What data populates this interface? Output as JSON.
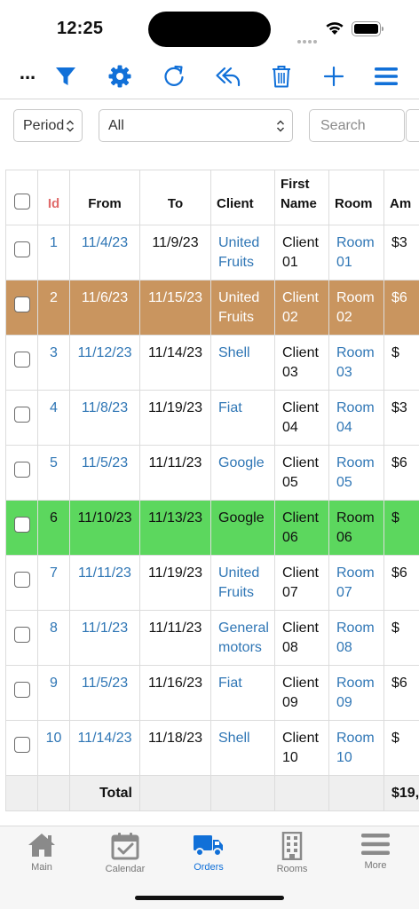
{
  "status": {
    "time": "12:25"
  },
  "colors": {
    "accent": "#1170d8",
    "link": "#2f76b5",
    "row_highlight_brown": "#c9955f",
    "row_highlight_green": "#5cd75e"
  },
  "toolbar": {
    "more_label": "...",
    "icons": [
      "filter-icon",
      "gear-icon",
      "refresh-icon",
      "reply-icon",
      "trash-icon",
      "plus-icon",
      "menu-icon"
    ]
  },
  "filters": {
    "period": "Period",
    "scope": "All",
    "search_placeholder": "Search"
  },
  "table": {
    "headers": {
      "id": "Id",
      "from": "From",
      "to": "To",
      "client": "Client",
      "first_name_1": "First",
      "first_name_2": "Name",
      "room": "Room",
      "amount": "Am"
    },
    "rows": [
      {
        "id": "1",
        "from": "11/4/23",
        "to": "11/9/23",
        "client_1": "United",
        "client_2": "Fruits",
        "first_1": "Client",
        "first_2": "01",
        "room_1": "Room",
        "room_2": "01",
        "amount": "$3"
      },
      {
        "id": "2",
        "from": "11/6/23",
        "to": "11/15/23",
        "client_1": "United",
        "client_2": "Fruits",
        "first_1": "Client",
        "first_2": "02",
        "room_1": "Room",
        "room_2": "02",
        "amount": "$6"
      },
      {
        "id": "3",
        "from": "11/12/23",
        "to": "11/14/23",
        "client_1": "Shell",
        "client_2": "",
        "first_1": "Client",
        "first_2": "03",
        "room_1": "Room",
        "room_2": "03",
        "amount": "$"
      },
      {
        "id": "4",
        "from": "11/8/23",
        "to": "11/19/23",
        "client_1": "Fiat",
        "client_2": "",
        "first_1": "Client",
        "first_2": "04",
        "room_1": "Room",
        "room_2": "04",
        "amount": "$3"
      },
      {
        "id": "5",
        "from": "11/5/23",
        "to": "11/11/23",
        "client_1": "Google",
        "client_2": "",
        "first_1": "Client",
        "first_2": "05",
        "room_1": "Room",
        "room_2": "05",
        "amount": "$6"
      },
      {
        "id": "6",
        "from": "11/10/23",
        "to": "11/13/23",
        "client_1": "Google",
        "client_2": "",
        "first_1": "Client",
        "first_2": "06",
        "room_1": "Room",
        "room_2": "06",
        "amount": "$"
      },
      {
        "id": "7",
        "from": "11/11/23",
        "to": "11/19/23",
        "client_1": "United",
        "client_2": "Fruits",
        "first_1": "Client",
        "first_2": "07",
        "room_1": "Room",
        "room_2": "07",
        "amount": "$6"
      },
      {
        "id": "8",
        "from": "11/1/23",
        "to": "11/11/23",
        "client_1": "General",
        "client_2": "motors",
        "first_1": "Client",
        "first_2": "08",
        "room_1": "Room",
        "room_2": "08",
        "amount": "$"
      },
      {
        "id": "9",
        "from": "11/5/23",
        "to": "11/16/23",
        "client_1": "Fiat",
        "client_2": "",
        "first_1": "Client",
        "first_2": "09",
        "room_1": "Room",
        "room_2": "09",
        "amount": "$6"
      },
      {
        "id": "10",
        "from": "11/14/23",
        "to": "11/18/23",
        "client_1": "Shell",
        "client_2": "",
        "first_1": "Client",
        "first_2": "10",
        "room_1": "Room",
        "room_2": "10",
        "amount": "$"
      }
    ],
    "total_label": "Total",
    "total_amount": "$19,2"
  },
  "tabbar": {
    "items": [
      {
        "label": "Main",
        "icon": "home-icon"
      },
      {
        "label": "Calendar",
        "icon": "calendar-icon"
      },
      {
        "label": "Orders",
        "icon": "truck-icon",
        "active": true
      },
      {
        "label": "Rooms",
        "icon": "building-icon"
      },
      {
        "label": "More",
        "icon": "menu-icon"
      }
    ]
  }
}
